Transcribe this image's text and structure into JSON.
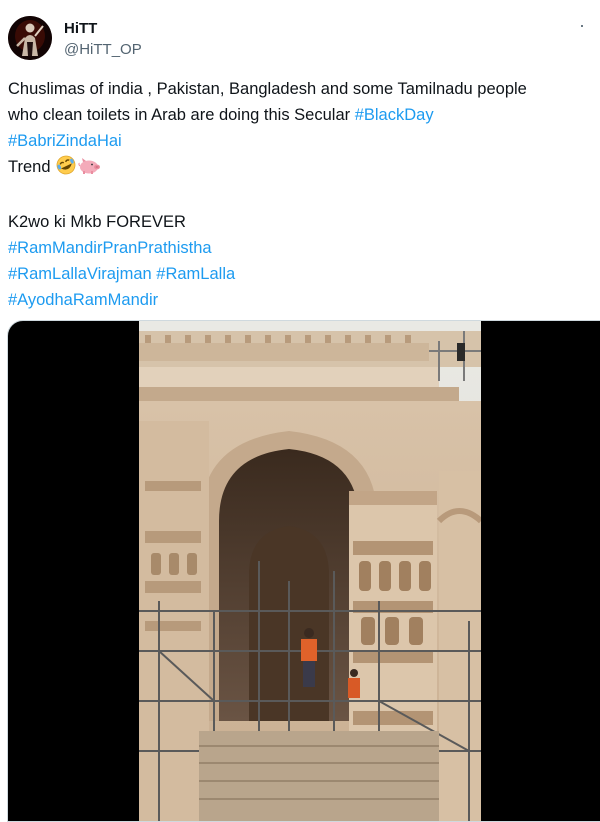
{
  "tweet": {
    "author": {
      "display_name": "HiTT",
      "handle": "@HiTT_OP",
      "avatar_icon": "avatar-icon"
    },
    "more_icon": "more-icon",
    "text": {
      "line1": "Chuslimas of india , Pakistan, Bangladesh and some Tamilnadu people",
      "line2_prefix": "who clean toilets in Arab are doing this Secular ",
      "hashtag_blackday": "#BlackDay",
      "hashtag_babri": "#BabriZindaHai",
      "trend_word": "Trend",
      "emoji_laugh": "rolling-on-floor-laughing-icon",
      "emoji_pig": "pig-icon",
      "line_k2wo": "K2wo ki Mkb FOREVER",
      "hashtag_pran": "#RamMandirPranPrathistha",
      "hashtag_virajman": "#RamLallaVirajman",
      "hashtag_ramlalla": "#RamLalla",
      "hashtag_ayodha": "#AyodhaRamMandir"
    },
    "media": {
      "type": "video",
      "description_icon": "temple-video-thumbnail"
    },
    "colors": {
      "hashtag": "#1d9bf0",
      "text": "#0f1419",
      "secondary": "#536471"
    }
  }
}
